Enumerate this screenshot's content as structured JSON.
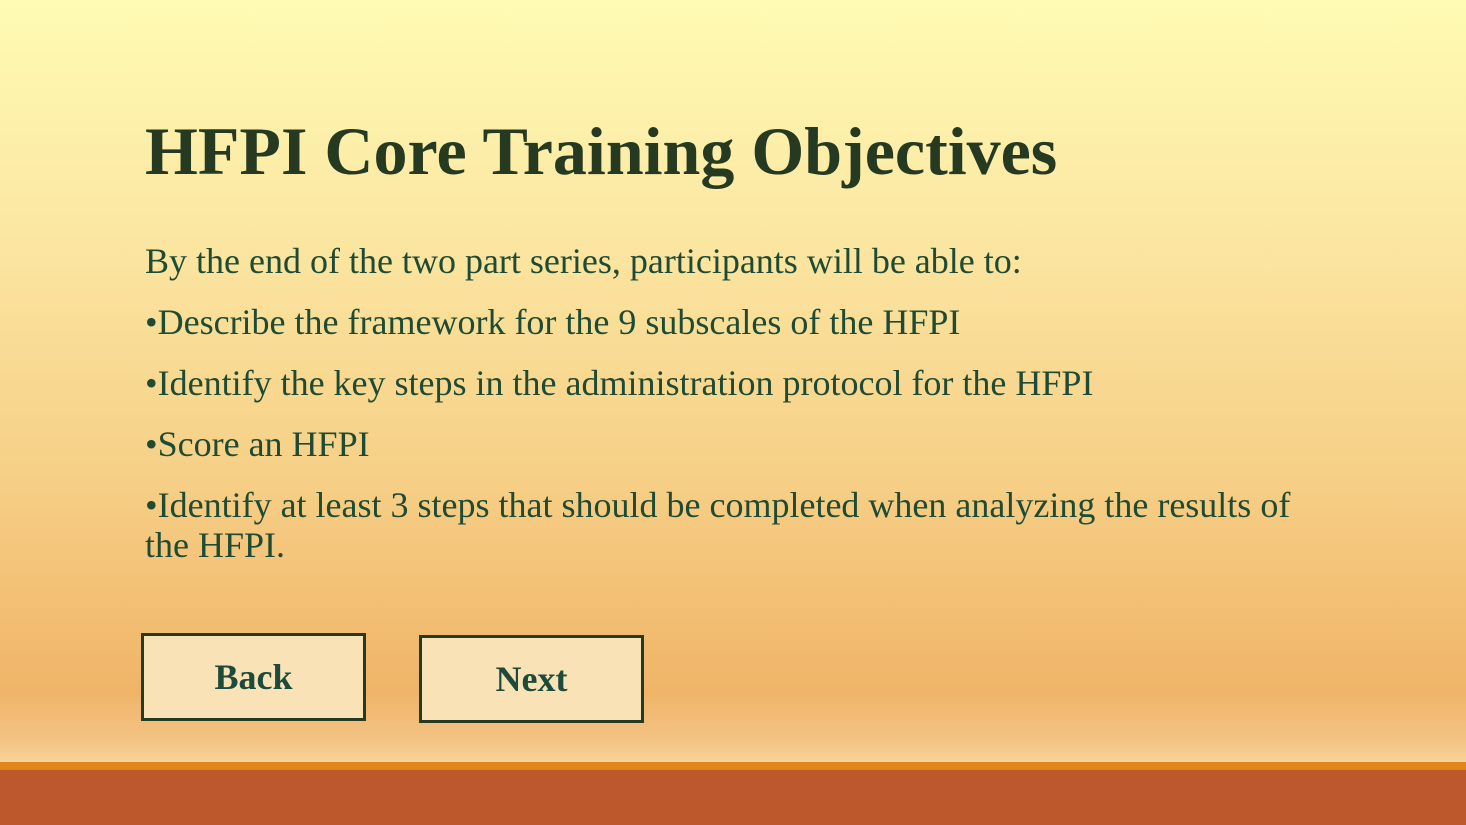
{
  "slide": {
    "title": "HFPI Core Training Objectives",
    "intro": "By the end of the two part series, participants will be able to:",
    "bullets": [
      "•Describe the framework for the 9 subscales of the HFPI",
      "•Identify the key steps in the administration protocol for the HFPI",
      "•Score an HFPI",
      "•Identify at least 3 steps that should be completed when analyzing the results of the HFPI."
    ]
  },
  "navigation": {
    "back_label": "Back",
    "next_label": "Next"
  },
  "colors": {
    "title": "#263a22",
    "body_text": "#1f4a33",
    "button_fill": "#f9e3b6",
    "footer_accent": "#e0861c",
    "footer_bar": "#bc582b"
  }
}
